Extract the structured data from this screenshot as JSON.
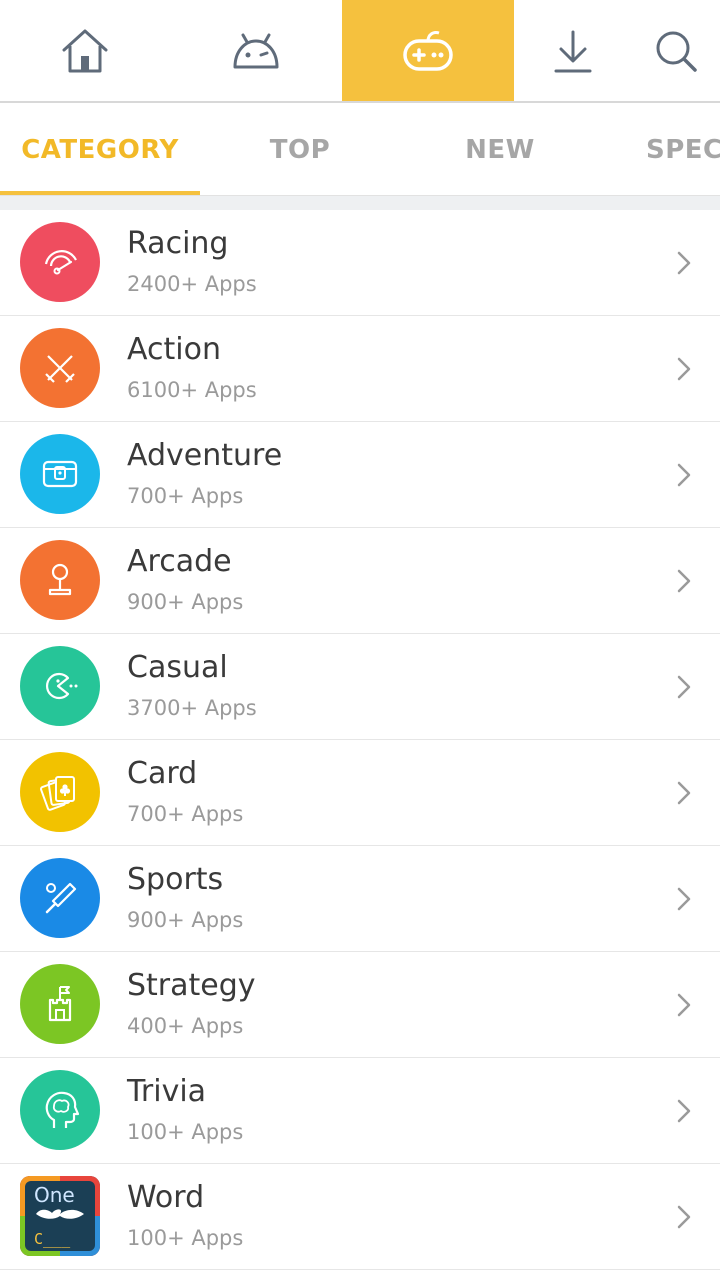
{
  "topnav": {
    "items": [
      {
        "name": "home-icon",
        "active": false
      },
      {
        "name": "android-icon",
        "active": false
      },
      {
        "name": "gamepad-icon",
        "active": true
      },
      {
        "name": "download-icon",
        "active": false
      },
      {
        "name": "search-icon",
        "active": false
      }
    ],
    "active_color": "#f5c13e"
  },
  "tabs": [
    {
      "label": "CATEGORY",
      "active": true
    },
    {
      "label": "TOP",
      "active": false
    },
    {
      "label": "NEW",
      "active": false
    },
    {
      "label": "SPECI",
      "active": false
    }
  ],
  "categories": [
    {
      "name": "Racing",
      "count": "2400+ Apps",
      "icon": "speedometer-icon",
      "color": "#ef4d5f"
    },
    {
      "name": "Action",
      "count": "6100+ Apps",
      "icon": "crossed-swords-icon",
      "color": "#f37232"
    },
    {
      "name": "Adventure",
      "count": "700+ Apps",
      "icon": "treasure-chest-icon",
      "color": "#1bb7ea"
    },
    {
      "name": "Arcade",
      "count": "900+ Apps",
      "icon": "joystick-icon",
      "color": "#f37232"
    },
    {
      "name": "Casual",
      "count": "3700+ Apps",
      "icon": "pacman-icon",
      "color": "#26c598"
    },
    {
      "name": "Card",
      "count": "700+ Apps",
      "icon": "playing-cards-icon",
      "color": "#f2c200"
    },
    {
      "name": "Sports",
      "count": "900+ Apps",
      "icon": "bat-ball-icon",
      "color": "#1a8ae6"
    },
    {
      "name": "Strategy",
      "count": "400+ Apps",
      "icon": "castle-flag-icon",
      "color": "#7cc624"
    },
    {
      "name": "Trivia",
      "count": "100+ Apps",
      "icon": "head-brain-icon",
      "color": "#26c598"
    },
    {
      "name": "Word",
      "count": "100+ Apps",
      "icon": "one-mustache-app-icon",
      "color": "#1b3f55",
      "icon_text": "One",
      "icon_subtext": "C___"
    }
  ]
}
